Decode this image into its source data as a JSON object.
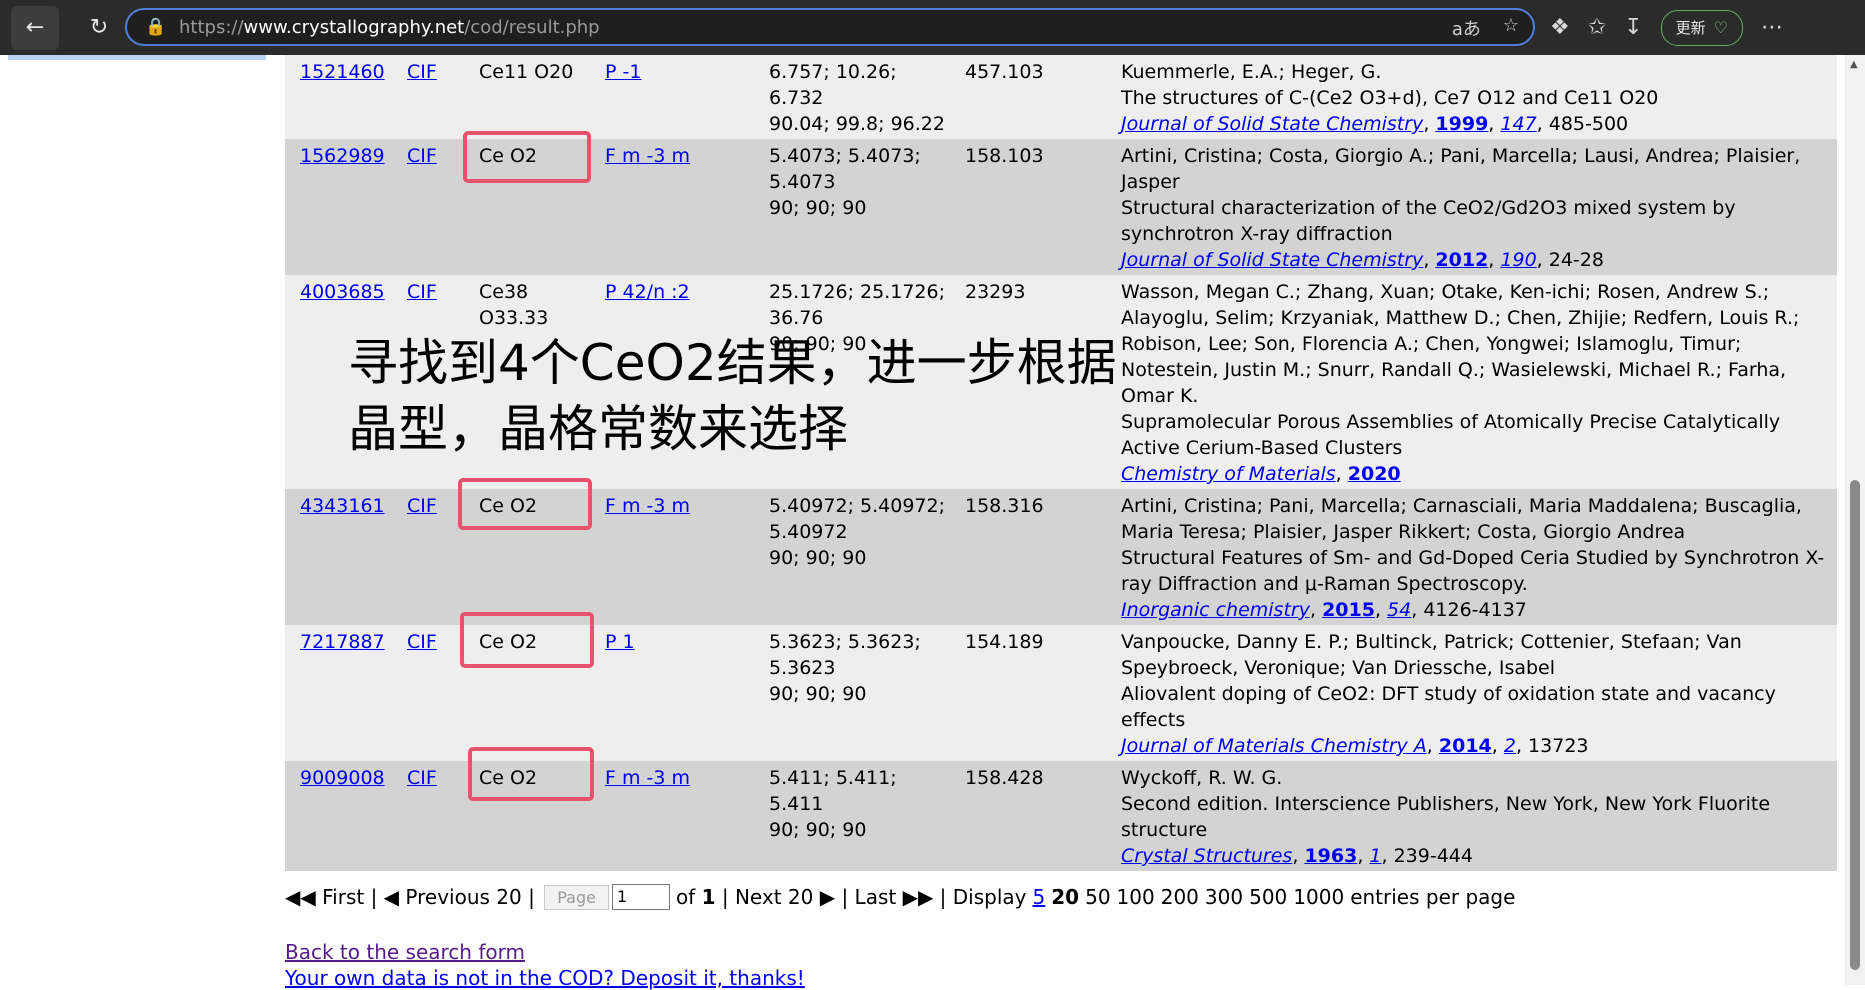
{
  "browser": {
    "url_prefix": "https://",
    "url_host": "www.crystallography.net",
    "url_path": "/cod/result.php",
    "read_aloud": "aあ",
    "update_label": "更新"
  },
  "rows": [
    {
      "id": "1521460",
      "cif": "CIF",
      "formula": "Ce11 O20",
      "sg": "P -1",
      "cell1": "6.757; 10.26; 6.732",
      "cell2": "90.04; 99.8; 96.22",
      "cell3": "",
      "vol": "457.103",
      "authors": "Kuemmerle, E.A.; Heger, G.",
      "title": "The structures of C-(Ce2 O3+d), Ce7 O12 and Ce11 O20",
      "journal": "Journal of Solid State Chemistry",
      "year": "1999",
      "volume": "147",
      "pages": ", 485-500"
    },
    {
      "id": "1562989",
      "cif": "CIF",
      "formula": "Ce O2",
      "sg": "F m -3 m",
      "cell1": "5.4073; 5.4073;",
      "cell2": "5.4073",
      "cell3": "90; 90; 90",
      "vol": "158.103",
      "authors": "Artini, Cristina; Costa, Giorgio A.; Pani, Marcella; Lausi, Andrea; Plaisier, Jasper",
      "title": "Structural characterization of the CeO2/Gd2O3 mixed system by synchrotron X-ray diffraction",
      "journal": "Journal of Solid State Chemistry",
      "year": "2012",
      "volume": "190",
      "pages": ", 24-28"
    },
    {
      "id": "4003685",
      "cif": "CIF",
      "formula": "Ce38 O33.33",
      "sg": "P 42/n :2",
      "cell1": "25.1726; 25.1726;",
      "cell2": "36.76",
      "cell3": "90; 90; 90",
      "vol": "23293",
      "authors": "Wasson, Megan C.; Zhang, Xuan; Otake, Ken-ichi; Rosen, Andrew S.; Alayoglu, Selim; Krzyaniak, Matthew D.; Chen, Zhijie; Redfern, Louis R.; Robison, Lee; Son, Florencia A.; Chen, Yongwei; Islamoglu, Timur; Notestein, Justin M.; Snurr, Randall Q.; Wasielewski, Michael R.; Farha, Omar K.",
      "title": "Supramolecular Porous Assemblies of Atomically Precise Catalytically Active Cerium-Based Clusters",
      "journal": "Chemistry of Materials",
      "year": "2020",
      "volume": "",
      "pages": ""
    },
    {
      "id": "4343161",
      "cif": "CIF",
      "formula": "Ce O2",
      "sg": "F m -3 m",
      "cell1": "5.40972; 5.40972;",
      "cell2": "5.40972",
      "cell3": "90; 90; 90",
      "vol": "158.316",
      "authors": "Artini, Cristina; Pani, Marcella; Carnasciali, Maria Maddalena; Buscaglia, Maria Teresa; Plaisier, Jasper Rikkert; Costa, Giorgio Andrea",
      "title": "Structural Features of Sm- and Gd-Doped Ceria Studied by Synchrotron X-ray Diffraction and μ-Raman Spectroscopy.",
      "journal": "Inorganic chemistry",
      "year": "2015",
      "volume": "54",
      "pages": ", 4126-4137"
    },
    {
      "id": "7217887",
      "cif": "CIF",
      "formula": "Ce O2",
      "sg": "P 1",
      "cell1": "5.3623; 5.3623;",
      "cell2": "5.3623",
      "cell3": "90; 90; 90",
      "vol": "154.189",
      "authors": "Vanpoucke, Danny E. P.; Bultinck, Patrick; Cottenier, Stefaan; Van Speybroeck, Veronique; Van Driessche, Isabel",
      "title": "Aliovalent doping of CeO2: DFT study of oxidation state and vacancy effects",
      "journal": "Journal of Materials Chemistry A",
      "year": "2014",
      "volume": "2",
      "pages": ", 13723"
    },
    {
      "id": "9009008",
      "cif": "CIF",
      "formula": "Ce O2",
      "sg": "F m -3 m",
      "cell1": "5.411; 5.411; 5.411",
      "cell2": "90; 90; 90",
      "cell3": "",
      "vol": "158.428",
      "authors": "Wyckoff, R. W. G.",
      "title": "Second edition. Interscience Publishers, New York, New York Fluorite structure",
      "journal": "Crystal Structures",
      "year": "1963",
      "volume": "1",
      "pages": ", 239-444"
    }
  ],
  "overlay": {
    "line1": "寻找到4个CeO2结果，进一步根据",
    "line2": "晶型，晶格常数来选择"
  },
  "pager": {
    "first": "◀◀ First",
    "prev": "◀ Previous 20",
    "page_btn": "Page",
    "page_value": "1",
    "of_label": "of",
    "total_pages": "1",
    "next": "Next 20 ▶",
    "last": "Last ▶▶",
    "display_label": "Display",
    "opt_5": "5",
    "opt_20": "20",
    "opt_50": "50",
    "opt_100": "100",
    "opt_200": "200",
    "opt_300": "300",
    "opt_500": "500",
    "opt_1000": "1000",
    "suffix": "entries per page"
  },
  "links": {
    "back": "Back to the search form",
    "own_data": "Your own data is not in the COD? Deposit it, thanks!"
  }
}
